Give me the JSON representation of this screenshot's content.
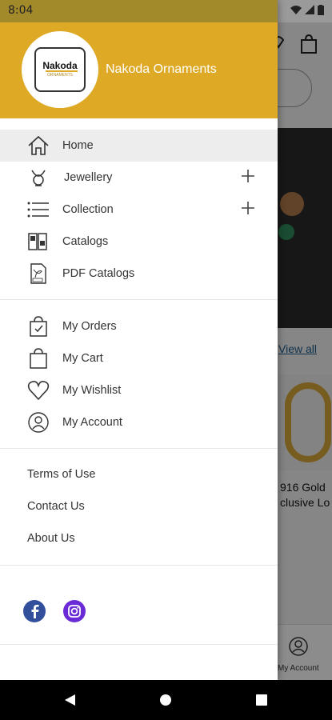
{
  "status": {
    "time": "8:04"
  },
  "drawer": {
    "header": {
      "logo_text": "Nakoda",
      "logo_sub": "ORNAMENTS",
      "store_name": "Nakoda Ornaments",
      "bg_color": "#deaa26"
    },
    "main_items": [
      {
        "label": "Home",
        "icon": "home-icon",
        "active": true
      },
      {
        "label": "Jewellery",
        "icon": "necklace-icon",
        "expandable": true
      },
      {
        "label": "Collection",
        "icon": "list-icon",
        "expandable": true
      },
      {
        "label": "Catalogs",
        "icon": "catalog-icon"
      },
      {
        "label": "PDF Catalogs",
        "icon": "pdf-icon"
      }
    ],
    "account_items": [
      {
        "label": "My Orders",
        "icon": "orders-bag-icon"
      },
      {
        "label": "My Cart",
        "icon": "cart-bag-icon"
      },
      {
        "label": "My Wishlist",
        "icon": "heart-icon"
      },
      {
        "label": "My Account",
        "icon": "user-icon"
      }
    ],
    "info_items": [
      {
        "label": "Terms of Use"
      },
      {
        "label": "Contact Us"
      },
      {
        "label": "About Us"
      }
    ],
    "social": [
      {
        "name": "facebook-icon",
        "color": "#314f9a"
      },
      {
        "name": "instagram-icon",
        "color": "#6a2bd6"
      }
    ]
  },
  "background": {
    "view_all": "View all",
    "product_name": "916 Gold\nclusive Lo",
    "bottom_nav_label": "My Account"
  }
}
